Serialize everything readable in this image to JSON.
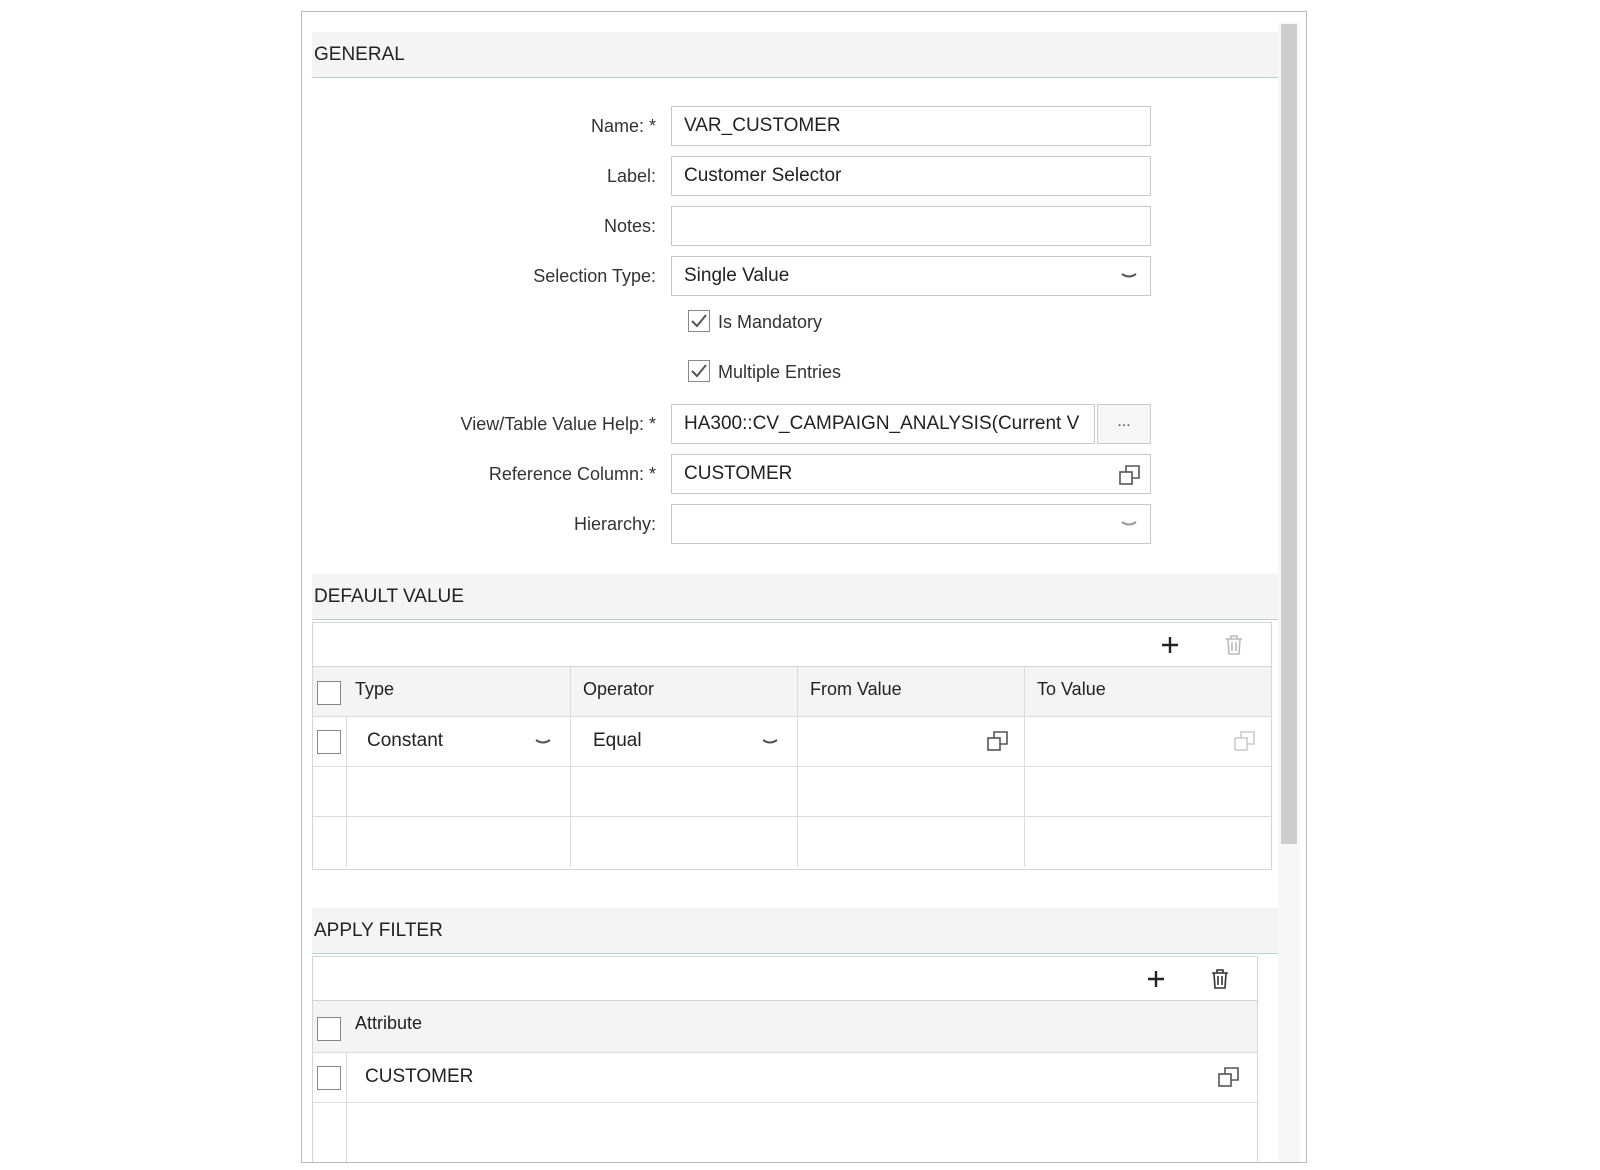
{
  "general": {
    "header": "GENERAL",
    "fields": {
      "name": {
        "label": "Name: *",
        "value": "VAR_CUSTOMER"
      },
      "label": {
        "label": "Label:",
        "value": "Customer Selector"
      },
      "notes": {
        "label": "Notes:",
        "value": ""
      },
      "selection_type": {
        "label": "Selection Type:",
        "value": "Single Value"
      },
      "is_mandatory": {
        "label": "Is Mandatory",
        "checked": true
      },
      "multiple_entries": {
        "label": "Multiple Entries",
        "checked": true
      },
      "value_help": {
        "label": "View/Table Value Help: *",
        "value": "HA300::CV_CAMPAIGN_ANALYSIS(Current V",
        "browse": "..."
      },
      "reference_column": {
        "label": "Reference Column: *",
        "value": "CUSTOMER"
      },
      "hierarchy": {
        "label": "Hierarchy:",
        "value": ""
      }
    }
  },
  "default_value": {
    "header": "DEFAULT VALUE",
    "columns": [
      "Type",
      "Operator",
      "From Value",
      "To Value"
    ],
    "rows": [
      {
        "type": "Constant",
        "operator": "Equal",
        "from": "",
        "to": ""
      }
    ]
  },
  "apply_filter": {
    "header": "APPLY FILTER",
    "columns": [
      "Attribute"
    ],
    "rows": [
      {
        "attribute": "CUSTOMER"
      }
    ]
  },
  "icons": {
    "add": "plus-icon",
    "delete": "trash-icon",
    "dropdown": "chevron-down-icon",
    "value-help": "copy-icon"
  }
}
